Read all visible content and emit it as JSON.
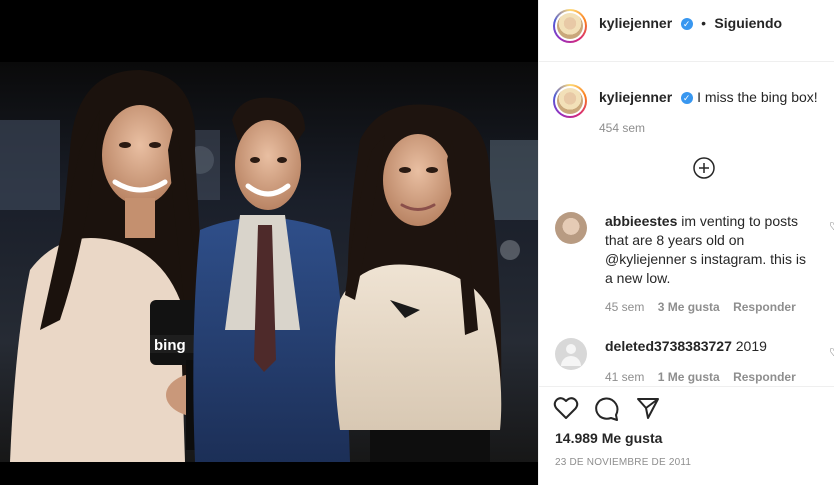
{
  "post": {
    "username": "kyliejenner",
    "follow_status": "Siguiendo",
    "separator": "•",
    "verified_icon": "check-icon"
  },
  "caption": {
    "username": "kyliejenner",
    "text": "I miss the bing box!",
    "time": "454 sem"
  },
  "load_more_icon": "plus-circle-icon",
  "comments": [
    {
      "username": "abbieestes",
      "text": "im venting to posts that are 8 years old on @kyliejenner s instagram. this is a new low.",
      "time": "45 sem",
      "likes": "3 Me gusta",
      "reply": "Responder"
    },
    {
      "username": "deleted3738383727",
      "text": "2019",
      "time": "41 sem",
      "likes": "1 Me gusta",
      "reply": "Responder"
    }
  ],
  "likes_count": "14.989 Me gusta",
  "post_date": "23 DE NOVIEMBRE DE 2011",
  "photo": {
    "mic_logo": "bing"
  },
  "colors": {
    "verified": "#3897f0",
    "text": "#262626",
    "secondary": "#8e8e8e"
  }
}
